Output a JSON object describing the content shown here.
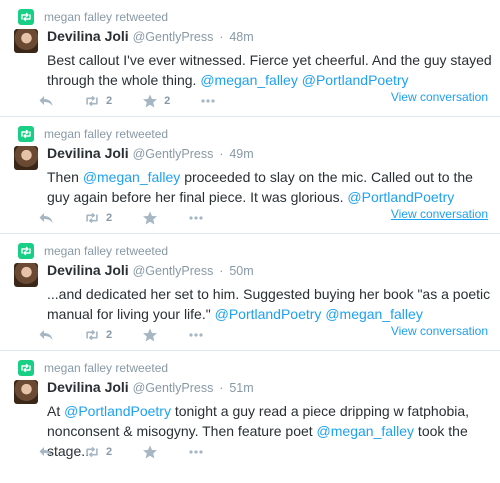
{
  "tweets": [
    {
      "retweet_label": "megan falley retweeted",
      "name": "Devilina Joli",
      "handle": "@GentlyPress",
      "time": "48m",
      "text_parts": [
        {
          "t": "Best callout I've ever witnessed. Fierce yet cheerful. And the guy stayed through the whole thing. ",
          "m": false
        },
        {
          "t": "@megan_falley",
          "m": true
        },
        {
          "t": " ",
          "m": false
        },
        {
          "t": "@PortlandPoetry",
          "m": true
        }
      ],
      "retweets": "2",
      "favorites": "2",
      "view_conversation": "View conversation"
    },
    {
      "retweet_label": "megan falley retweeted",
      "name": "Devilina Joli",
      "handle": "@GentlyPress",
      "time": "49m",
      "text_parts": [
        {
          "t": "Then ",
          "m": false
        },
        {
          "t": "@megan_falley",
          "m": true
        },
        {
          "t": " proceeded to slay on the mic. Called out to the guy again before her final piece. It was glorious. ",
          "m": false
        },
        {
          "t": "@PortlandPoetry",
          "m": true
        }
      ],
      "retweets": "2",
      "favorites": "",
      "view_conversation": "View conversation"
    },
    {
      "retweet_label": "megan falley retweeted",
      "name": "Devilina Joli",
      "handle": "@GentlyPress",
      "time": "50m",
      "text_parts": [
        {
          "t": "...and dedicated her set to him. Suggested buying her book \"as a poetic manual for living your life.\" ",
          "m": false
        },
        {
          "t": "@PortlandPoetry",
          "m": true
        },
        {
          "t": " ",
          "m": false
        },
        {
          "t": "@megan_falley",
          "m": true
        }
      ],
      "retweets": "2",
      "favorites": "",
      "view_conversation": "View conversation"
    },
    {
      "retweet_label": "megan falley retweeted",
      "name": "Devilina Joli",
      "handle": "@GentlyPress",
      "time": "51m",
      "text_parts": [
        {
          "t": "At ",
          "m": false
        },
        {
          "t": "@PortlandPoetry",
          "m": true
        },
        {
          "t": " tonight a guy read a piece dripping w fatphobia, nonconsent & misogyny. Then feature poet ",
          "m": false
        },
        {
          "t": "@megan_falley",
          "m": true
        },
        {
          "t": " took the stage...",
          "m": false
        }
      ],
      "retweets": "2",
      "favorites": "",
      "view_conversation": ""
    }
  ],
  "separator": "·",
  "icons": {
    "retweet_badge": "retweet-icon",
    "reply": "reply-icon",
    "retweet": "retweet-icon",
    "favorite": "star-icon",
    "more": "more-icon"
  },
  "colors": {
    "link": "#1da1f2",
    "muted": "#8899a6",
    "retweet_badge": "#19cf86",
    "text": "#292f33"
  }
}
